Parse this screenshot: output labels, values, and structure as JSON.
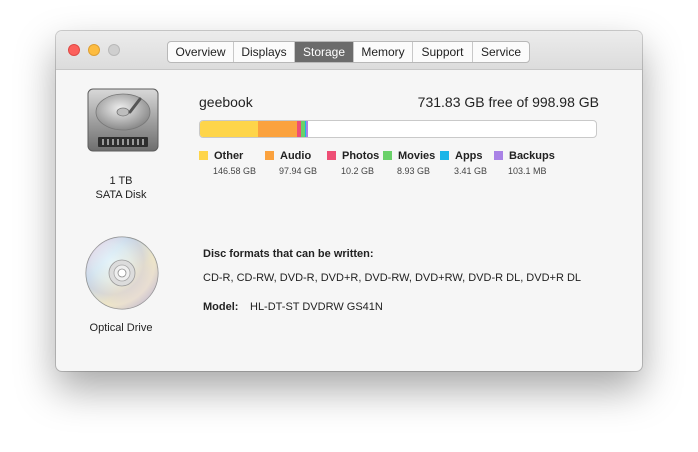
{
  "window": {
    "controls": [
      "close",
      "minimize",
      "zoom"
    ]
  },
  "tabs": [
    {
      "label": "Overview"
    },
    {
      "label": "Displays"
    },
    {
      "label": "Storage",
      "active": true
    },
    {
      "label": "Memory"
    },
    {
      "label": "Support"
    },
    {
      "label": "Service"
    }
  ],
  "disk": {
    "icon": "hard-disk-icon",
    "size_label": "1 TB",
    "type_label": "SATA Disk",
    "name": "geebook",
    "free_text": "731.83 GB free of 998.98 GB",
    "total_gb": 998.98,
    "categories": [
      {
        "name": "Other",
        "size": "146.58 GB",
        "gb": 146.58,
        "color": "#fed54a"
      },
      {
        "name": "Audio",
        "size": "97.94 GB",
        "gb": 97.94,
        "color": "#fba23e"
      },
      {
        "name": "Photos",
        "size": "10.2 GB",
        "gb": 10.2,
        "color": "#ee4e75"
      },
      {
        "name": "Movies",
        "size": "8.93 GB",
        "gb": 8.93,
        "color": "#6ad169"
      },
      {
        "name": "Apps",
        "size": "3.41 GB",
        "gb": 3.41,
        "color": "#1ab5e8"
      },
      {
        "name": "Backups",
        "size": "103.1 MB",
        "gb": 0.1031,
        "color": "#a982e6"
      }
    ]
  },
  "optical": {
    "icon": "optical-disc-icon",
    "label": "Optical Drive",
    "formats_title": "Disc formats that can be written:",
    "formats": "CD-R, CD-RW, DVD-R, DVD+R, DVD-RW, DVD+RW, DVD-R DL, DVD+R DL",
    "model_label": "Model:",
    "model_value": "HL-DT-ST DVDRW GS41N"
  }
}
